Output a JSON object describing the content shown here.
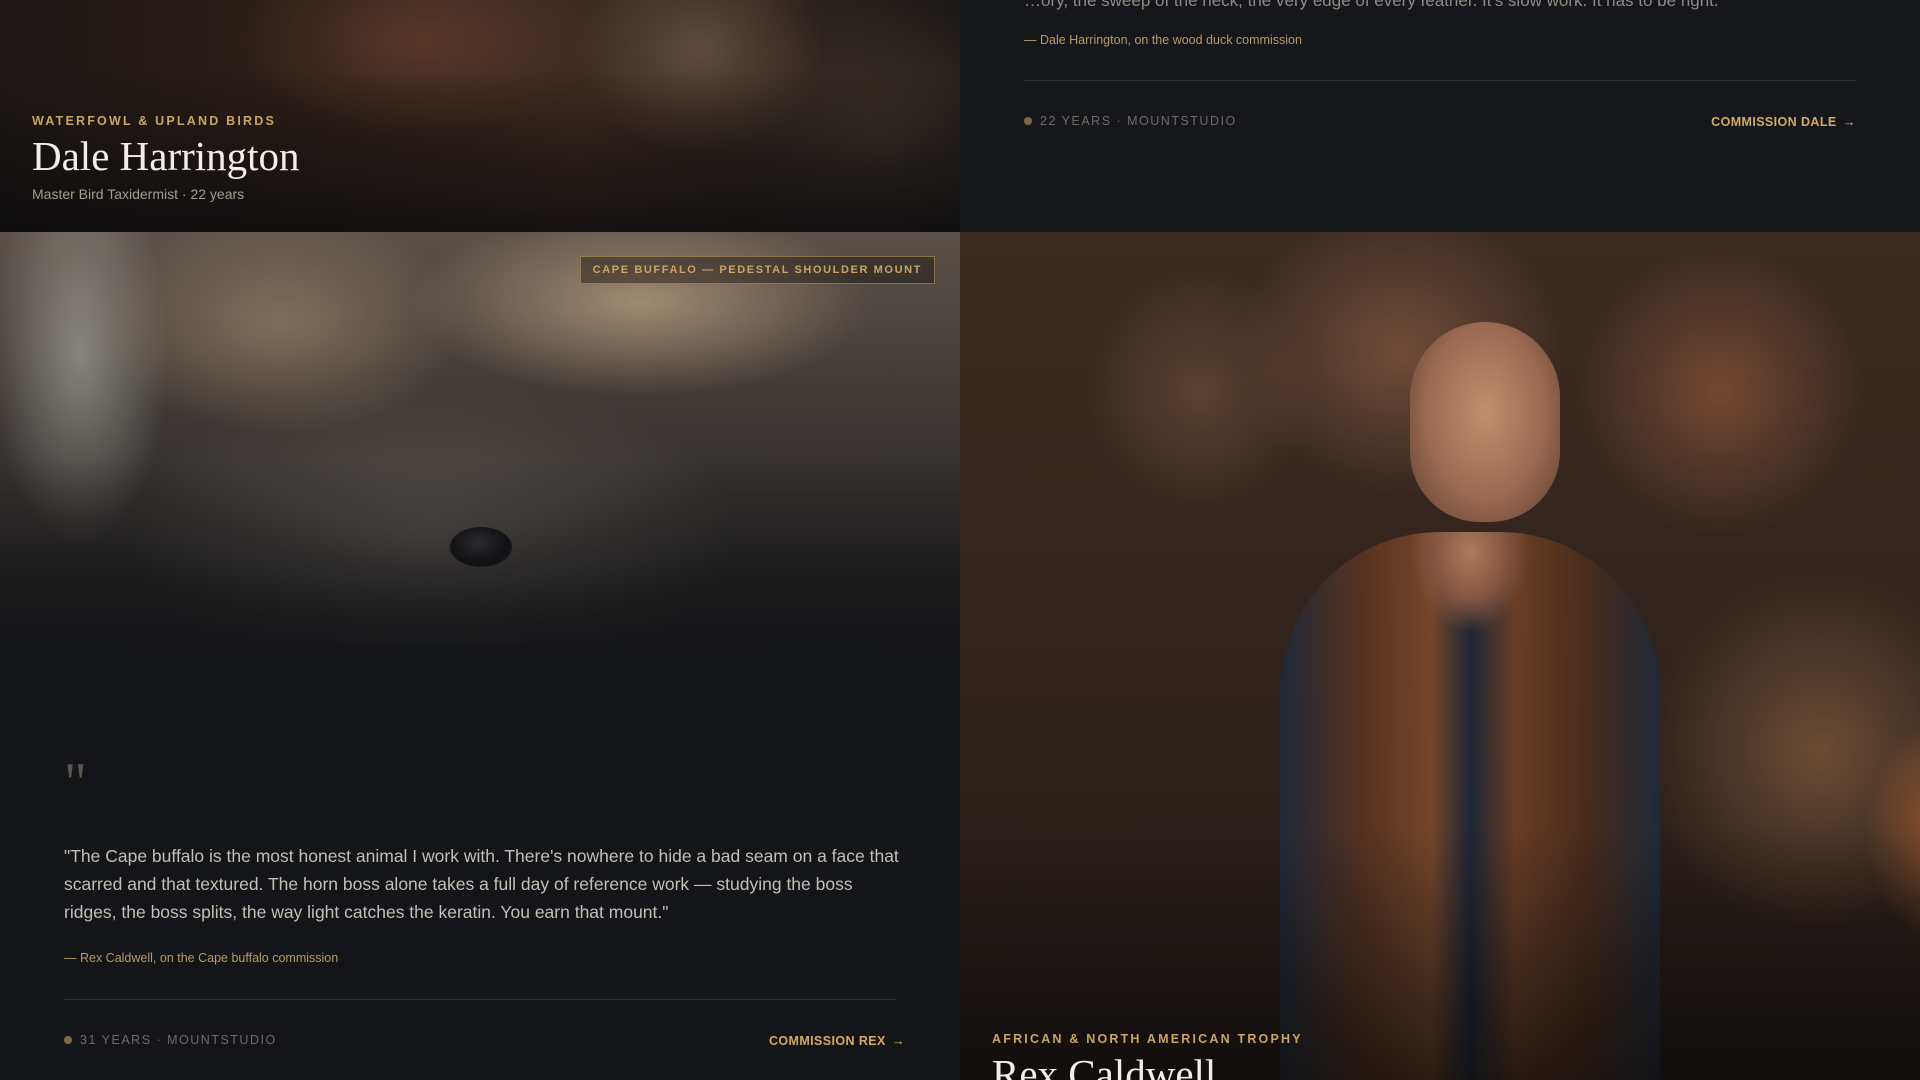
{
  "dale": {
    "eyebrow": "WATERFOWL & UPLAND BIRDS",
    "name": "Dale Harrington",
    "subtitle": "Master Bird Taxidermist · 22 years",
    "quote_partial": "…ory, the sweep of the neck, the very edge of every feather. It's slow work. It has to be right.",
    "attribution": "— Dale Harrington, on the wood duck commission",
    "meta": "22 YEARS · MOUNTSTUDIO",
    "cta": "COMMISSION DALE",
    "arrow": "→"
  },
  "rex": {
    "tag": "CAPE BUFFALO — PEDESTAL SHOULDER MOUNT",
    "quote_mark": "\"",
    "quote": "\"The Cape buffalo is the most honest animal I work with. There's nowhere to hide a bad seam on a face that scarred and that textured. The horn boss alone takes a full day of reference work — studying the boss ridges, the boss splits, the way light catches the keratin. You earn that mount.\"",
    "attribution": "— Rex Caldwell, on the Cape buffalo commission",
    "meta": "31 YEARS · MOUNTSTUDIO",
    "cta": "COMMISSION REX",
    "arrow": "→",
    "eyebrow": "AFRICAN & NORTH AMERICAN TROPHY",
    "name": "Rex Caldwell"
  },
  "colors": {
    "accent_gold": "#c9a565",
    "background": "#141518",
    "card": "#15171b"
  },
  "icons": {
    "arrow": "arrow-right-icon",
    "dot": "status-dot-icon"
  }
}
